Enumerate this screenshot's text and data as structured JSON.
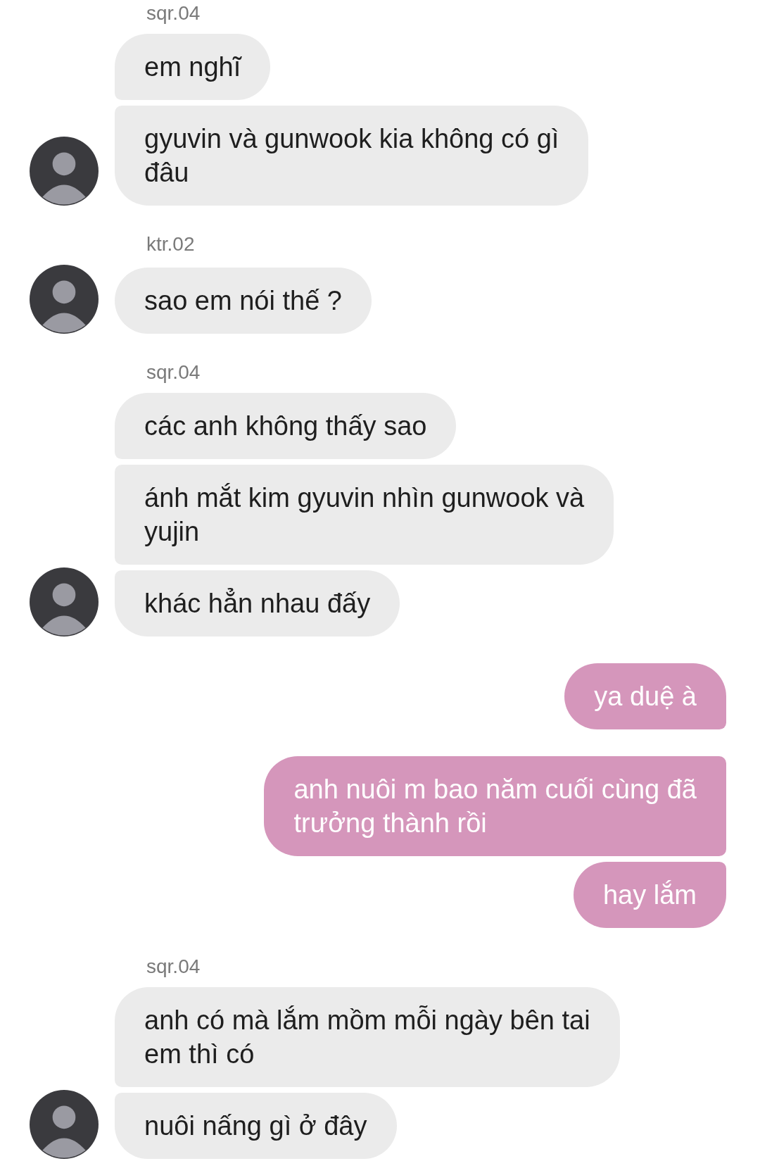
{
  "groups": [
    {
      "kind": "incoming",
      "sender": "sqr.04",
      "messages": [
        "em nghĩ",
        "gyuvin và gunwook kia không có gì\nđâu"
      ]
    },
    {
      "kind": "incoming",
      "sender": "ktr.02",
      "messages": [
        "sao em nói thế ?"
      ]
    },
    {
      "kind": "incoming",
      "sender": "sqr.04",
      "messages": [
        "các anh không thấy sao",
        "ánh mắt kim gyuvin nhìn gunwook và\nyujin",
        "khác hẳn nhau đấy"
      ]
    },
    {
      "kind": "outgoing",
      "messages": [
        "ya duệ à"
      ]
    },
    {
      "kind": "outgoing",
      "messages": [
        "anh nuôi m bao năm cuối cùng đã\ntrưởng thành rồi",
        "hay lắm"
      ]
    },
    {
      "kind": "incoming",
      "sender": "sqr.04",
      "messages": [
        "anh có mà lắm mồm mỗi ngày bên tai\nem thì có",
        "nuôi nấng gì ở đây"
      ]
    }
  ]
}
